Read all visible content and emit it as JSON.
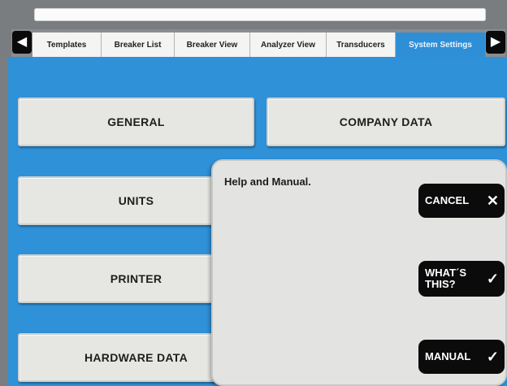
{
  "tabs": [
    {
      "label": "Templates",
      "active": false
    },
    {
      "label": "Breaker List",
      "active": false
    },
    {
      "label": "Breaker View",
      "active": false
    },
    {
      "label": "Analyzer View",
      "active": false
    },
    {
      "label": "Transducers",
      "active": false
    },
    {
      "label": "System Settings",
      "active": true
    }
  ],
  "nav": {
    "prev_icon": "arrow-left-icon",
    "next_icon": "arrow-right-icon"
  },
  "menu": {
    "general": "GENERAL",
    "company_data": "COMPANY DATA",
    "units": "UNITS",
    "printer": "PRINTER",
    "hardware_data": "HARDWARE DATA"
  },
  "help_popup": {
    "text": "Help and Manual.",
    "cancel_label": "CANCEL",
    "whats_this_line1": "WHAT´S",
    "whats_this_line2": "THIS?",
    "manual_label": "MANUAL"
  },
  "colors": {
    "accent": "#2f91d8",
    "active_tab": "#2f8fd6",
    "button_dark": "#0b0b0b"
  }
}
